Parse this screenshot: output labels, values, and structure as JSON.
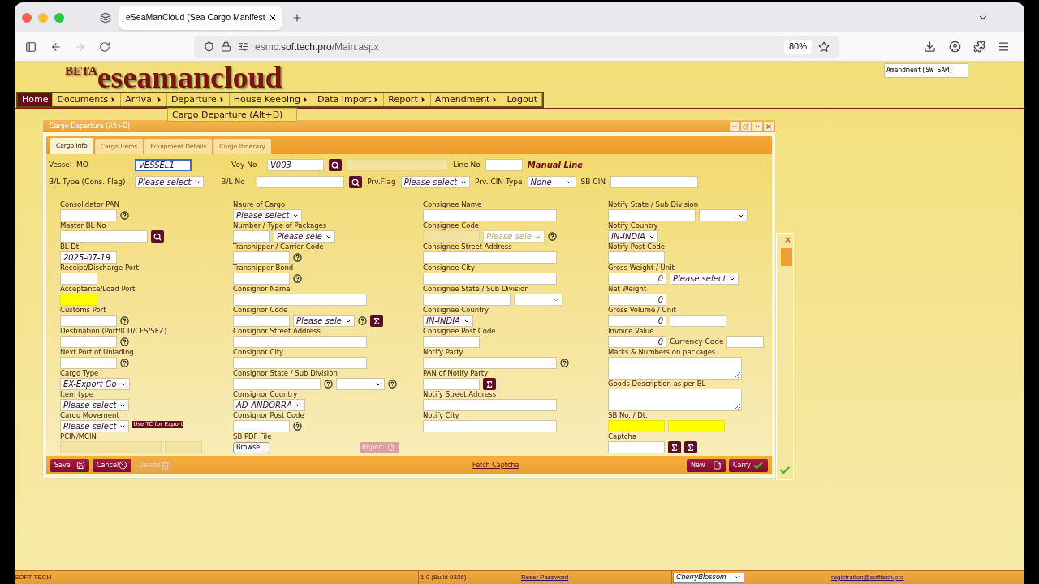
{
  "browser": {
    "tab_title": "eSeaManCloud (Sea Cargo Manifest",
    "url": "esmc.**softtech.pro**/Main.aspx",
    "zoom": "80%"
  },
  "logo": {
    "prefix": "BETA",
    "name": "eseamancloud"
  },
  "amendment_note": "Amendment(SW SAM)",
  "menu": [
    {
      "label": "Home",
      "selected": true,
      "submenu": false
    },
    {
      "label": "Documents",
      "selected": false,
      "submenu": true
    },
    {
      "label": "Arrival",
      "selected": false,
      "submenu": true
    },
    {
      "label": "Departure",
      "selected": false,
      "submenu": true,
      "dropdown": [
        "Cargo Departure (Alt+D)"
      ]
    },
    {
      "label": "House Keeping",
      "selected": false,
      "submenu": true
    },
    {
      "label": "Data Import",
      "selected": false,
      "submenu": true
    },
    {
      "label": "Report",
      "selected": false,
      "submenu": true
    },
    {
      "label": "Amendment",
      "selected": false,
      "submenu": true
    },
    {
      "label": "Logout",
      "selected": false,
      "submenu": false
    }
  ],
  "dialog": {
    "title": "Cargo Departure (Alt+D)",
    "tabs": [
      {
        "label": "Cargo Info",
        "selected": true
      },
      {
        "label": "Cargo Items",
        "selected": false
      },
      {
        "label": "Equipment Details",
        "selected": false
      },
      {
        "label": "Cargo Itinerary",
        "selected": false
      }
    ],
    "header_rows": [
      [
        {
          "kind": "label",
          "text": "Vessel IMO"
        },
        {
          "kind": "input",
          "value": "VESSEL1",
          "focused": true,
          "disabled": false
        },
        {
          "kind": "text",
          "text": "Voy No"
        },
        {
          "kind": "input",
          "value": "V003",
          "focused": false,
          "disabled": false
        },
        {
          "kind": "search"
        },
        {
          "kind": "wide-input",
          "focused": false,
          "disabled": true
        },
        {
          "kind": "text",
          "text": "Line No"
        },
        {
          "kind": "short-input",
          "focused": false,
          "disabled": false
        },
        {
          "kind": "emphasis",
          "text": "Manual Line"
        }
      ],
      [
        {
          "kind": "label",
          "text": "B/L Type (Cons. Flag)"
        },
        {
          "kind": "select",
          "value": "Please select",
          "focused": false,
          "disabled": false
        },
        {
          "kind": "text",
          "text": "B/L No"
        },
        {
          "kind": "mid-input",
          "focused": false,
          "disabled": false
        },
        {
          "kind": "search"
        },
        {
          "kind": "text",
          "text": "Prv.Flag"
        },
        {
          "kind": "select",
          "value": "Please select",
          "focused": false,
          "disabled": false
        },
        {
          "kind": "text",
          "text": "Prv. CIN Type"
        },
        {
          "kind": "select",
          "value": "None",
          "focused": false,
          "disabled": false
        },
        {
          "kind": "text",
          "text": "SB CIN"
        },
        {
          "kind": "mid-input",
          "focused": false,
          "disabled": false
        }
      ]
    ],
    "columns": [
      {
        "fields": [
          {
            "label": "Consolidator PAN",
            "controls": [
              {
                "kind": "input",
                "required": false,
                "disabled": false
              },
              {
                "kind": "help"
              }
            ]
          },
          {
            "label": "Master BL No",
            "controls": [
              {
                "kind": "mid-input",
                "required": false,
                "disabled": false
              },
              {
                "kind": "search"
              }
            ]
          },
          {
            "label": "BL Dt",
            "controls": [
              {
                "kind": "input",
                "value": "2025-07-19",
                "required": false,
                "disabled": false
              }
            ]
          },
          {
            "label": "Receipt/Discharge Port",
            "controls": [
              {
                "kind": "short-input",
                "required": false,
                "disabled": false
              }
            ]
          },
          {
            "label": "Acceptance/Load Port",
            "controls": [
              {
                "kind": "short-input",
                "required": true,
                "disabled": false
              }
            ]
          },
          {
            "label": "Customs Port",
            "controls": [
              {
                "kind": "input",
                "required": false,
                "disabled": false
              },
              {
                "kind": "help"
              }
            ]
          },
          {
            "label": "Destination (Port/ICD/CFS/SEZ)",
            "controls": [
              {
                "kind": "input",
                "required": false,
                "disabled": false
              },
              {
                "kind": "help"
              }
            ]
          },
          {
            "label": "Next Port of Unlading",
            "controls": [
              {
                "kind": "input",
                "required": false,
                "disabled": false
              },
              {
                "kind": "help"
              }
            ]
          },
          {
            "label": "Cargo Type",
            "controls": [
              {
                "kind": "select",
                "value": "EX-Export Go",
                "required": false,
                "disabled": false
              }
            ]
          },
          {
            "label": "Item type",
            "controls": [
              {
                "kind": "select",
                "value": "Please select",
                "required": false,
                "disabled": false
              }
            ]
          },
          {
            "label": "Cargo Movement",
            "controls": [
              {
                "kind": "select",
                "value": "Please select",
                "required": false,
                "disabled": false
              },
              {
                "kind": "note",
                "text": "Use TC for Export"
              }
            ]
          },
          {
            "label": "PCIN/MCIN",
            "controls": [
              {
                "kind": "wide-input",
                "required": false,
                "disabled": true
              },
              {
                "kind": "short-input",
                "required": false,
                "disabled": true
              }
            ]
          }
        ]
      },
      {
        "fields": [
          {
            "label": "Naure of Cargo",
            "controls": [
              {
                "kind": "select",
                "value": "Please select",
                "required": false,
                "disabled": false
              }
            ]
          },
          {
            "label": "Number / Type of Packages",
            "controls": [
              {
                "kind": "short-input",
                "required": false,
                "disabled": false
              },
              {
                "kind": "select",
                "value": "Please sele",
                "required": false,
                "disabled": false
              }
            ]
          },
          {
            "label": "Transhipper / Carrier Code",
            "controls": [
              {
                "kind": "input",
                "required": false,
                "disabled": false
              },
              {
                "kind": "help"
              }
            ]
          },
          {
            "label": "Transhipper Bond",
            "controls": [
              {
                "kind": "input",
                "required": false,
                "disabled": false
              },
              {
                "kind": "help"
              }
            ]
          },
          {
            "label": "Consignor Name",
            "controls": [
              {
                "kind": "long-input",
                "required": false,
                "disabled": false
              }
            ]
          },
          {
            "label": "Consignor Code",
            "controls": [
              {
                "kind": "input",
                "required": false,
                "disabled": false
              },
              {
                "kind": "select",
                "value": "Please sele",
                "required": false,
                "disabled": false
              },
              {
                "kind": "help"
              },
              {
                "kind": "sigma"
              }
            ]
          },
          {
            "label": "Consignor Street Address",
            "controls": [
              {
                "kind": "long-input",
                "required": false,
                "disabled": false
              }
            ]
          },
          {
            "label": "Consignor City",
            "controls": [
              {
                "kind": "long-input",
                "required": false,
                "disabled": false
              }
            ]
          },
          {
            "label": "Consignor State / Sub Division",
            "controls": [
              {
                "kind": "mid-input",
                "required": false,
                "disabled": false
              },
              {
                "kind": "help"
              },
              {
                "kind": "select",
                "required": false,
                "disabled": false
              },
              {
                "kind": "help"
              }
            ]
          },
          {
            "label": "Consignor Country",
            "controls": [
              {
                "kind": "select",
                "value": "AD-ANDORRA",
                "required": false,
                "disabled": false
              }
            ]
          },
          {
            "label": "Consignor Post Code",
            "controls": [
              {
                "kind": "input",
                "required": false,
                "disabled": false
              },
              {
                "kind": "help"
              }
            ]
          },
          {
            "label": "SB PDF File",
            "controls": [
              {
                "kind": "file-button",
                "text": "Browse..."
              },
              {
                "kind": "import-button",
                "text": "Import",
                "disabled": true
              }
            ]
          }
        ]
      },
      {
        "fields": [
          {
            "label": "Consignee Name",
            "controls": [
              {
                "kind": "long-input",
                "required": false,
                "disabled": false
              }
            ]
          },
          {
            "label": "Consignee Code",
            "controls": [
              {
                "kind": "input",
                "required": false,
                "disabled": true
              },
              {
                "kind": "select",
                "value": "Please sele",
                "required": false,
                "disabled": true
              },
              {
                "kind": "help"
              }
            ]
          },
          {
            "label": "Consignee Street Address",
            "controls": [
              {
                "kind": "long-input",
                "required": false,
                "disabled": false
              }
            ]
          },
          {
            "label": "Consignee City",
            "controls": [
              {
                "kind": "long-input",
                "required": false,
                "disabled": false
              }
            ]
          },
          {
            "label": "Consignee State / Sub Division",
            "controls": [
              {
                "kind": "mid-input",
                "required": false,
                "disabled": false
              },
              {
                "kind": "select",
                "required": false,
                "disabled": true
              }
            ]
          },
          {
            "label": "Consignee Country",
            "controls": [
              {
                "kind": "select",
                "value": "IN-INDIA",
                "required": false,
                "disabled": false
              }
            ]
          },
          {
            "label": "Consignee Post Code",
            "controls": [
              {
                "kind": "input",
                "required": false,
                "disabled": false
              }
            ]
          },
          {
            "label": "Notify Party",
            "controls": [
              {
                "kind": "long-input",
                "required": false,
                "disabled": false
              },
              {
                "kind": "help"
              }
            ]
          },
          {
            "label": "PAN of Notify Party",
            "controls": [
              {
                "kind": "input",
                "required": false,
                "disabled": false
              },
              {
                "kind": "sigma"
              }
            ]
          },
          {
            "label": "Notify Street Address",
            "controls": [
              {
                "kind": "long-input",
                "required": false,
                "disabled": false
              }
            ]
          },
          {
            "label": "Notify City",
            "controls": [
              {
                "kind": "long-input",
                "required": false,
                "disabled": false
              }
            ]
          }
        ]
      },
      {
        "fields": [
          {
            "label": "Notify State / Sub Division",
            "controls": [
              {
                "kind": "mid-input",
                "required": false,
                "disabled": false
              },
              {
                "kind": "select",
                "required": false,
                "disabled": false
              }
            ]
          },
          {
            "label": "Notify Country",
            "controls": [
              {
                "kind": "select",
                "value": "IN-INDIA",
                "required": false,
                "disabled": false
              }
            ]
          },
          {
            "label": "Notify Post Code",
            "controls": [
              {
                "kind": "input",
                "required": false,
                "disabled": false
              }
            ]
          },
          {
            "label": "Gross Weight / Unit",
            "controls": [
              {
                "kind": "number-input",
                "value": "0",
                "required": false,
                "disabled": false
              },
              {
                "kind": "select",
                "value": "Please select",
                "required": false,
                "disabled": false
              }
            ]
          },
          {
            "label": "Net Weight",
            "controls": [
              {
                "kind": "number-input",
                "value": "0",
                "required": false,
                "disabled": false
              }
            ]
          },
          {
            "label": "Gross Volume / Unit",
            "controls": [
              {
                "kind": "number-input",
                "value": "0",
                "required": false,
                "disabled": false
              },
              {
                "kind": "input",
                "required": false,
                "disabled": false
              }
            ]
          },
          {
            "label": "Invoice Value",
            "controls": [
              {
                "kind": "number-input",
                "value": "0",
                "required": false,
                "disabled": false
              },
              {
                "kind": "text",
                "text": "Currency Code"
              },
              {
                "kind": "short-input",
                "required": false,
                "disabled": false
              }
            ]
          },
          {
            "label": "Marks & Numbers on packages",
            "controls": [
              {
                "kind": "textarea",
                "required": false,
                "disabled": false
              }
            ]
          },
          {
            "label": "Goods Description as per BL",
            "controls": [
              {
                "kind": "textarea",
                "required": false,
                "disabled": false
              }
            ]
          },
          {
            "label": "SB No. / Dt.",
            "controls": [
              {
                "kind": "input",
                "required": true,
                "disabled": false
              },
              {
                "kind": "input",
                "required": true,
                "disabled": false
              }
            ]
          },
          {
            "label": "Captcha",
            "controls": [
              {
                "kind": "input",
                "required": false,
                "disabled": false
              },
              {
                "kind": "sigma"
              },
              {
                "kind": "sigma"
              }
            ]
          }
        ]
      }
    ],
    "footer_left": [
      {
        "label": "Save",
        "kind": "save",
        "disabled": false
      },
      {
        "label": "Cancel",
        "kind": "cancel",
        "disabled": false
      },
      {
        "label": "Delete",
        "kind": "delete",
        "disabled": true
      }
    ],
    "footer_link": "Fetch Captcha",
    "footer_right": [
      {
        "label": "New",
        "kind": "new",
        "disabled": false
      },
      {
        "label": "Carry",
        "kind": "carry",
        "disabled": false
      }
    ]
  },
  "status_bar": {
    "company": "SOFT-TECH",
    "version": "1.0 (Build 9326)",
    "reset_link": "Reset Password",
    "theme": "CherryBlossom",
    "email": "registration@softtech.pro"
  }
}
